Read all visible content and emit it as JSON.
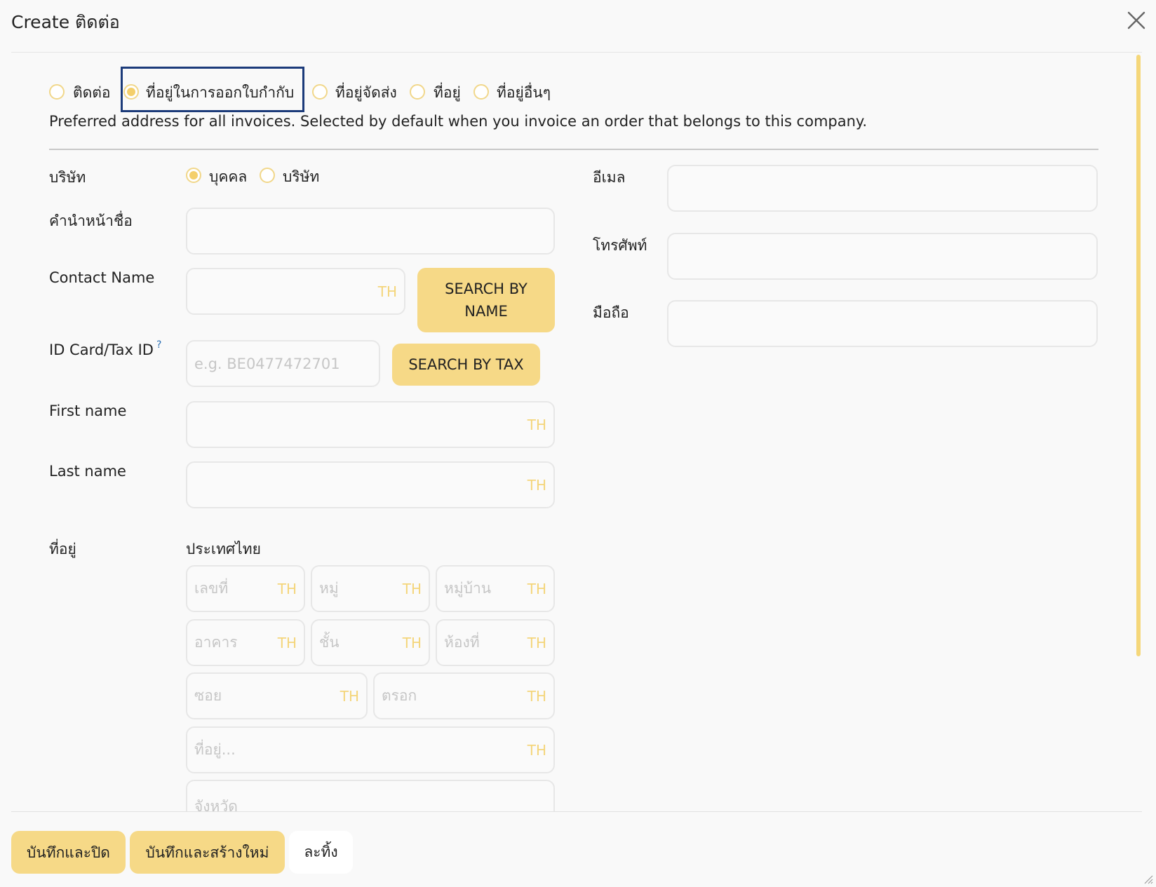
{
  "dialog": {
    "title": "Create ติดต่อ"
  },
  "address_types": {
    "options": [
      "ติดต่อ",
      "ที่อยู่ในการออกใบกำกับ",
      "ที่อยู่จัดส่ง",
      "ที่อยู่",
      "ที่อยู่อื่นๆ"
    ],
    "selected": "ที่อยู่ในการออกใบกำกับ",
    "description": "Preferred address for all invoices. Selected by default when you invoice an order that belongs to this company."
  },
  "form": {
    "company_type": {
      "label": "บริษัท",
      "options": [
        "บุคคล",
        "บริษัท"
      ],
      "selected": "บุคคล"
    },
    "title_label": "คำนำหน้าชื่อ",
    "title_value": "",
    "contact_name": {
      "label": "Contact Name",
      "lang": "TH",
      "value": ""
    },
    "search_by_name_label": "SEARCH BY NAME",
    "tax_id": {
      "label": "ID Card/Tax ID",
      "help": "?",
      "placeholder": "e.g. BE0477472701",
      "value": ""
    },
    "search_by_tax_label": "SEARCH BY TAX",
    "first_name": {
      "label": "First name",
      "lang": "TH",
      "value": ""
    },
    "last_name": {
      "label": "Last name",
      "lang": "TH",
      "value": ""
    },
    "address": {
      "label": "ที่อยู่",
      "country": "ประเทศไทย",
      "fields": {
        "house_no": {
          "placeholder": "เลขที่",
          "lang": "TH"
        },
        "moo": {
          "placeholder": "หมู่",
          "lang": "TH"
        },
        "village": {
          "placeholder": "หมู่บ้าน",
          "lang": "TH"
        },
        "building": {
          "placeholder": "อาคาร",
          "lang": "TH"
        },
        "floor": {
          "placeholder": "ชั้น",
          "lang": "TH"
        },
        "room": {
          "placeholder": "ห้องที่",
          "lang": "TH"
        },
        "soi": {
          "placeholder": "ซอย",
          "lang": "TH"
        },
        "alley": {
          "placeholder": "ตรอก",
          "lang": "TH"
        },
        "street": {
          "placeholder": "ที่อยู่...",
          "lang": "TH"
        },
        "province": {
          "placeholder": "จังหวัด"
        }
      }
    },
    "email": {
      "label": "อีเมล",
      "value": ""
    },
    "phone": {
      "label": "โทรศัพท์",
      "value": ""
    },
    "mobile": {
      "label": "มือถือ",
      "value": ""
    }
  },
  "footer": {
    "save_close": "บันทึกและปิด",
    "save_new": "บันทึกและสร้างใหม่",
    "discard": "ละทิ้ง"
  },
  "colors": {
    "accent": "#f6d987",
    "radio_border": "#f1d78a",
    "focus_border": "#1c3b7a",
    "lang_tag": "#f4d57a"
  }
}
